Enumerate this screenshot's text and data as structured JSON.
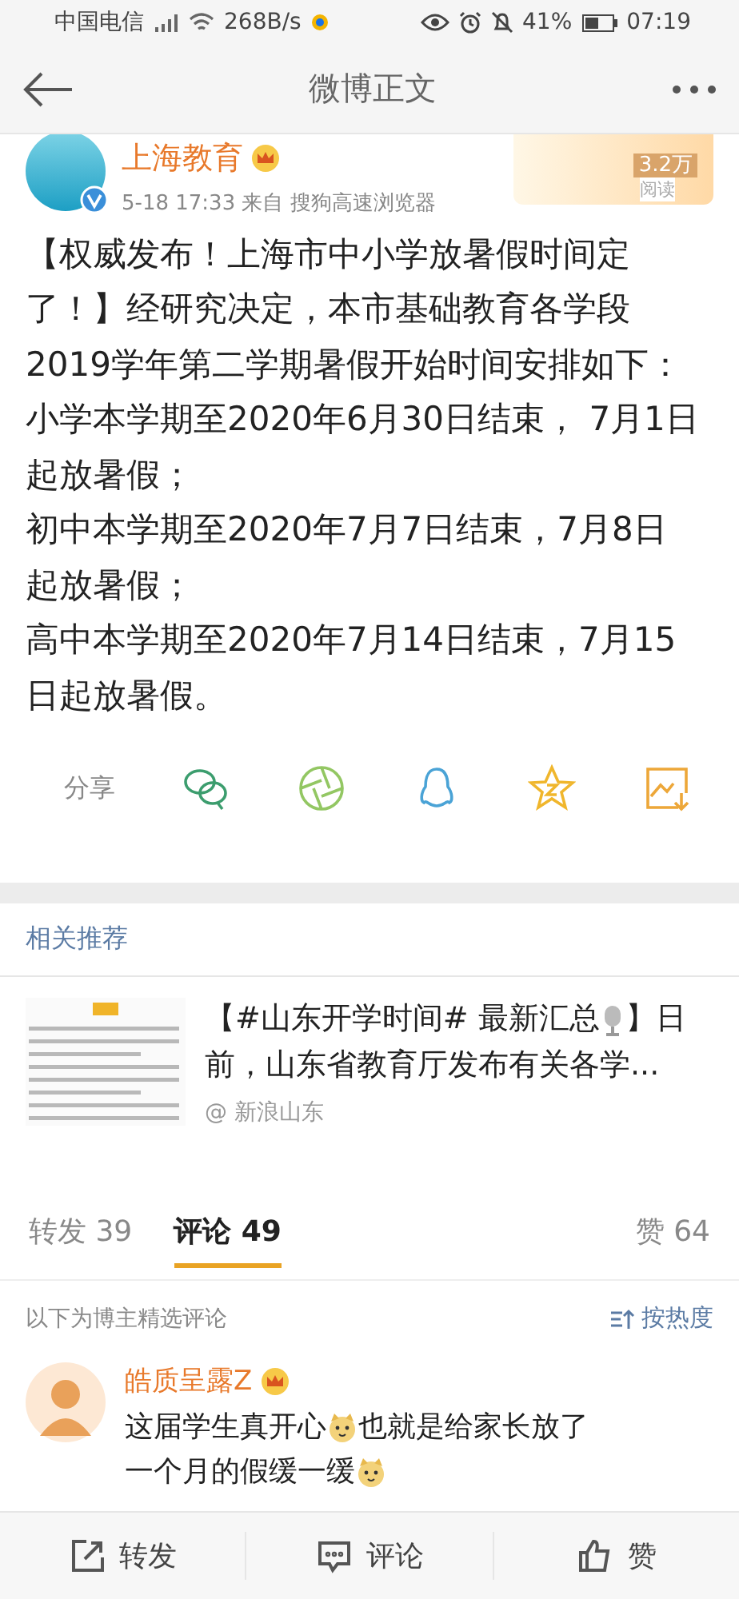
{
  "status_bar": {
    "carrier": "中国电信",
    "speed": "268B/s",
    "battery": "41%",
    "time": "07:19"
  },
  "nav": {
    "title": "微博正文"
  },
  "post": {
    "author": "上海教育",
    "meta": "5-18 17:33  来自 搜狗高速浏览器",
    "banner": {
      "count": "3.2万",
      "label": "阅读"
    },
    "lines": [
      "【权威发布！上海市中小学放暑假时间定",
      "了！】经研究决定，本市基础教育各学段",
      "2019学年第二学期暑假开始时间安排如下：",
      "小学本学期至2020年6月30日结束， 7月1日",
      "起放暑假；",
      "初中本学期至2020年7月7日结束，7月8日",
      "起放暑假；",
      "高中本学期至2020年7月14日结束，7月15",
      "日起放暑假。"
    ]
  },
  "share": {
    "label": "分享",
    "targets": [
      {
        "kind": "wechat",
        "color": "#3c9d6e"
      },
      {
        "kind": "aperture",
        "color": "#93c763"
      },
      {
        "kind": "penguin",
        "color": "#4aa3d6"
      },
      {
        "kind": "star",
        "color": "#f0b62c"
      },
      {
        "kind": "save",
        "color": "#eda739"
      }
    ]
  },
  "related": {
    "heading": "相关推荐",
    "item": {
      "title": [
        [
          {
            "kind": "text",
            "text": "【#山东开学时间# 最新汇总"
          },
          {
            "kind": "emoji"
          },
          {
            "kind": "text",
            "text": "】日"
          }
        ],
        [
          {
            "kind": "text",
            "text": "前，山东省教育厅发布有关各学..."
          }
        ]
      ],
      "source": "@ 新浪山东"
    }
  },
  "tabs": [
    {
      "label": "转发 39",
      "selected": false
    },
    {
      "label": "评论 49",
      "selected": true
    }
  ],
  "likes": "赞 64",
  "filter": {
    "note": "以下为博主精选评论",
    "sort": "按热度"
  },
  "comment": {
    "user": "皓质呈露Z",
    "body": [
      [
        {
          "kind": "text",
          "text": "这届学生真开心"
        },
        {
          "kind": "emoji"
        },
        {
          "kind": "text",
          "text": "也就是给家长放了"
        }
      ],
      [
        {
          "kind": "text",
          "text": "一个月的假缓一缓"
        },
        {
          "kind": "emoji"
        }
      ]
    ]
  },
  "actions": [
    {
      "kind": "repost",
      "label": "转发"
    },
    {
      "kind": "comment",
      "label": "评论"
    },
    {
      "kind": "like",
      "label": "赞"
    }
  ]
}
